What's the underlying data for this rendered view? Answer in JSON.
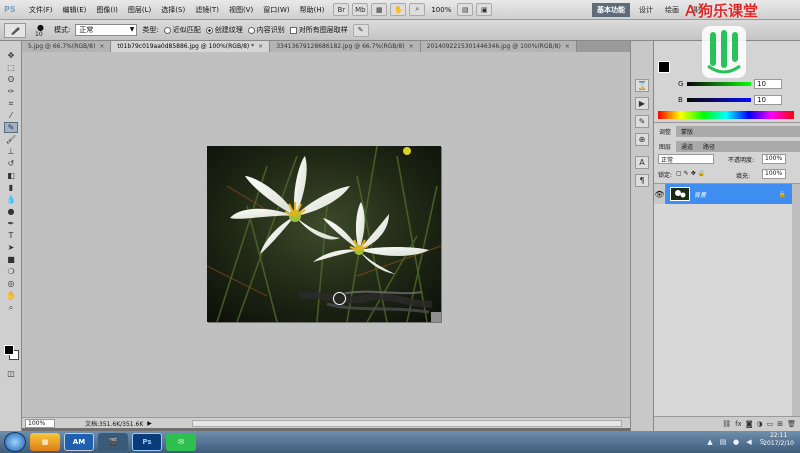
{
  "menubar": {
    "logo": "PS",
    "items": [
      "文件(F)",
      "编辑(E)",
      "图像(I)",
      "图层(L)",
      "选择(S)",
      "滤镜(T)",
      "视图(V)",
      "窗口(W)",
      "帮助(H)"
    ],
    "zoom": "100%",
    "workspaces": [
      "基本功能",
      "设计",
      "绘画",
      "摄影"
    ]
  },
  "options": {
    "brush_size": "10",
    "mode_label": "模式:",
    "mode_value": "正常",
    "type_label": "类型:",
    "radio_proximity": "近似匹配",
    "radio_texture": "创建纹理",
    "radio_content": "内容识别",
    "sample_all": "对所有图层取样"
  },
  "tabs": [
    {
      "label": "5.jpg @ 66.7%(RGB/8)",
      "active": false
    },
    {
      "label": "t01b79c019aa0d85886.jpg @ 100%(RGB/8) *",
      "active": true
    },
    {
      "label": "33413679128686182.jpg @ 66.7%(RGB/8)",
      "active": false
    },
    {
      "label": "2014092215301446346.jpg @ 100%(RGB/8)",
      "active": false
    }
  ],
  "status": {
    "zoom": "100%",
    "doc_info": "文档:351.6K/351.6K"
  },
  "color_panel": {
    "rows": [
      {
        "label": "G",
        "value": "10"
      },
      {
        "label": "B",
        "value": "10"
      }
    ]
  },
  "adjust_tabs": [
    "调整",
    "蒙版"
  ],
  "layers_tabs": [
    "图层",
    "通道",
    "路径"
  ],
  "layers": {
    "blend_mode": "正常",
    "opacity_label": "不透明度:",
    "opacity": "100%",
    "lock_label": "锁定:",
    "fill_label": "填充:",
    "fill": "100%",
    "list": [
      {
        "name": "背景",
        "visible": true,
        "locked": true
      }
    ]
  },
  "watermark": "Ａ狗乐课堂",
  "taskbar": {
    "apps": [
      "AM",
      "Ps"
    ],
    "time": "22:11",
    "date": "2017/2/10"
  }
}
